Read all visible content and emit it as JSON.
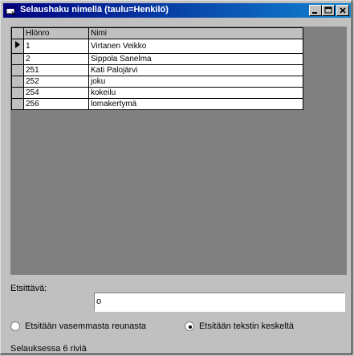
{
  "window": {
    "title": "Selaushaku nimellä (taulu=Henkilö)"
  },
  "grid": {
    "columns": [
      "Hlönro",
      "Nimi"
    ],
    "rows": [
      [
        "1",
        "Virtanen Veikko"
      ],
      [
        "2",
        "Sippola Sanelma"
      ],
      [
        "251",
        "Kati Palojärvi"
      ],
      [
        "252",
        "joku"
      ],
      [
        "254",
        "kokeilu"
      ],
      [
        "256",
        "lomakertymä"
      ]
    ]
  },
  "search": {
    "label": "Etsittävä:",
    "value": "o"
  },
  "options": {
    "left_label": "Etsitään vasemmasta reunasta",
    "middle_label": "Etsitään tekstin keskeltä",
    "selected": "middle"
  },
  "status": {
    "text": "Selauksessa 6 riviä"
  }
}
